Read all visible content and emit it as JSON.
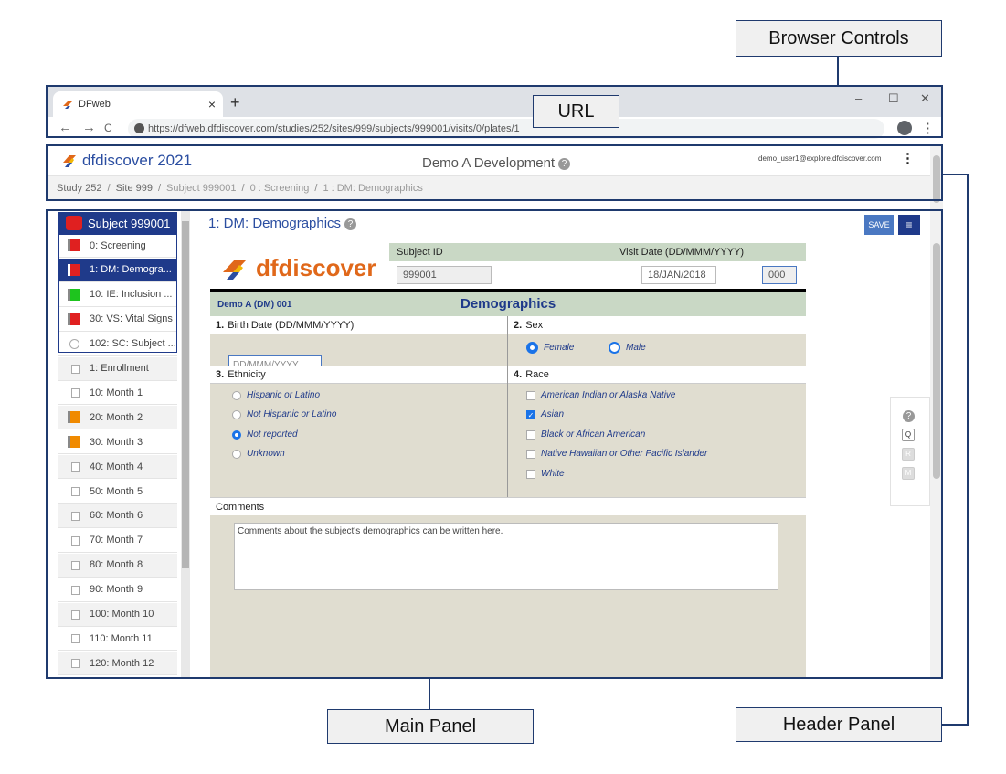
{
  "callouts": {
    "browser_controls": "Browser Controls",
    "url": "URL",
    "main_panel": "Main Panel",
    "header_panel": "Header Panel"
  },
  "browser": {
    "tab_title": "DFweb",
    "tab_close": "×",
    "new_tab": "+",
    "win_min": "–",
    "win_max": "☐",
    "win_close": "✕",
    "back": "←",
    "forward": "→",
    "reload": "C",
    "url": "https://dfweb.dfdiscover.com/studies/252/sites/999/subjects/999001/visits/0/plates/1",
    "menu": "⋮"
  },
  "header": {
    "logo_text": "dfdiscover 2021",
    "app_title": "Demo A Development",
    "user": "demo_user1@explore.dfdiscover.com",
    "menu": "⋮",
    "breadcrumb": [
      "Study 252",
      "Site 999",
      "Subject 999001",
      "0 : Screening",
      "1 : DM: Demographics"
    ],
    "breadcrumb_sep": "/"
  },
  "sidebar": {
    "subject": "Subject 999001",
    "items": [
      {
        "label": "0: Screening",
        "marker": "red"
      },
      {
        "label": "1: DM: Demogra...",
        "marker": "red",
        "selected": true
      },
      {
        "label": "10: IE: Inclusion ...",
        "marker": "green"
      },
      {
        "label": "30: VS: Vital Signs",
        "marker": "red"
      },
      {
        "label": "102: SC: Subject ...",
        "marker": "radio"
      },
      {
        "label": "1: Enrollment",
        "marker": "check"
      },
      {
        "label": "10: Month 1",
        "marker": "check"
      },
      {
        "label": "20: Month 2",
        "marker": "orange"
      },
      {
        "label": "30: Month 3",
        "marker": "orange"
      },
      {
        "label": "40: Month 4",
        "marker": "check"
      },
      {
        "label": "50: Month 5",
        "marker": "check"
      },
      {
        "label": "60: Month 6",
        "marker": "check"
      },
      {
        "label": "70: Month 7",
        "marker": "check"
      },
      {
        "label": "80: Month 8",
        "marker": "check"
      },
      {
        "label": "90: Month 9",
        "marker": "check"
      },
      {
        "label": "100: Month 10",
        "marker": "check"
      },
      {
        "label": "110: Month 11",
        "marker": "check"
      },
      {
        "label": "120: Month 12",
        "marker": "check"
      }
    ]
  },
  "main": {
    "plate_title": "1: DM: Demographics",
    "save_label": "SAVE",
    "menu_label": "≡"
  },
  "form": {
    "logo_text": "dfdiscover",
    "subject_id_label": "Subject ID",
    "visit_date_label": "Visit Date (DD/MMM/YYYY)",
    "subject_id_value": "999001",
    "visit_date_value": "18/JAN/2018",
    "visit_code_value": "000",
    "form_code": "Demo A (DM) 001",
    "form_title": "Demographics",
    "q1": {
      "num": "1.",
      "label": "Birth Date (DD/MMM/YYYY)",
      "placeholder": "DD/MMM/YYYY"
    },
    "q2": {
      "num": "2.",
      "label": "Sex",
      "options": [
        "Female",
        "Male"
      ],
      "selected": "Female"
    },
    "q3": {
      "num": "3.",
      "label": "Ethnicity",
      "options": [
        "Hispanic or Latino",
        "Not Hispanic or Latino",
        "Not reported",
        "Unknown"
      ],
      "selected": "Not reported"
    },
    "q4": {
      "num": "4.",
      "label": "Race",
      "options": [
        "American Indian or Alaska Native",
        "Asian",
        "Black or African American",
        "Native Hawaiian or Other Pacific Islander",
        "White"
      ],
      "checked": [
        "Asian"
      ]
    },
    "comments_label": "Comments",
    "comments_value": "Comments about the subject's demographics can be written here."
  },
  "toolpanel": {
    "help": "?",
    "q": "Q",
    "r": "R",
    "m": "M"
  },
  "colors": {
    "accent": "#1f3a8a",
    "annotation": "#1f3a6e",
    "form_bg": "#e0ddd0",
    "band": "#c9d8c5",
    "logo_orange": "#e0681a",
    "status_red": "#e02020",
    "status_green": "#1ec41e",
    "status_orange": "#f08a00"
  }
}
